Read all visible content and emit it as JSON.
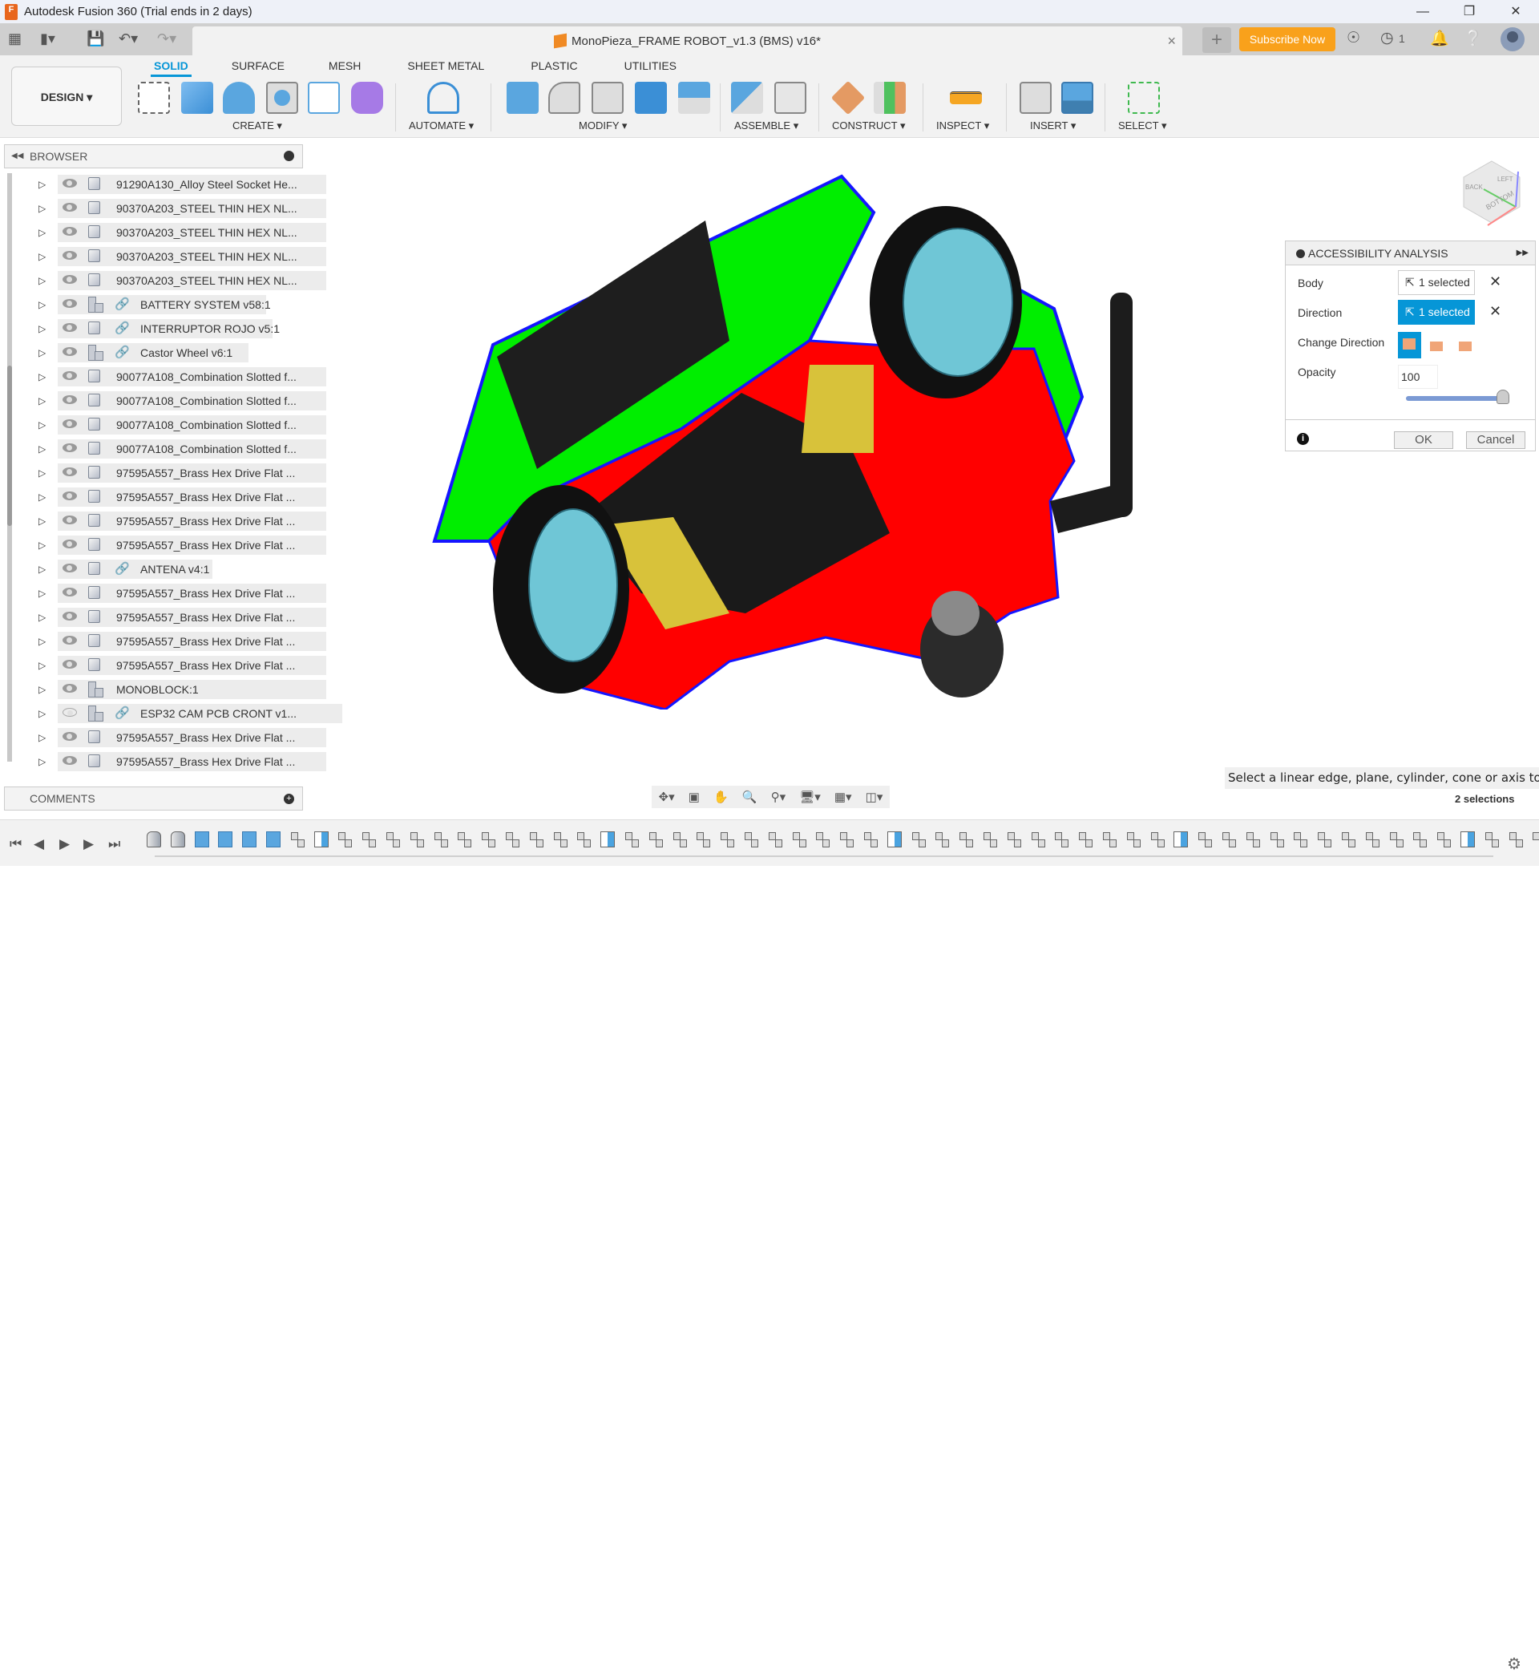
{
  "window": {
    "title": "Autodesk Fusion 360 (Trial ends in 2 days)",
    "app_icon_label": "F",
    "controls": [
      "minimize",
      "restore",
      "close"
    ]
  },
  "qat": {
    "icons": [
      "apps-grid-icon",
      "file-icon",
      "save-icon",
      "undo-icon",
      "redo-icon"
    ]
  },
  "document_tab": {
    "title": "MonoPieza_FRAME ROBOT_v1.3 (BMS) v16*",
    "close": "×"
  },
  "header_right": {
    "new_tab": "+",
    "subscribe_label": "Subscribe Now",
    "job_count": "1",
    "accent": "#f9a11b"
  },
  "ribbon": {
    "workspace": "DESIGN ▾",
    "tabs": [
      {
        "label": "SOLID",
        "active": true
      },
      {
        "label": "SURFACE",
        "active": false
      },
      {
        "label": "MESH",
        "active": false
      },
      {
        "label": "SHEET METAL",
        "active": false
      },
      {
        "label": "PLASTIC",
        "active": false
      },
      {
        "label": "UTILITIES",
        "active": false
      }
    ],
    "groups": [
      {
        "label": "CREATE ▾"
      },
      {
        "label": "AUTOMATE ▾"
      },
      {
        "label": "MODIFY ▾"
      },
      {
        "label": "ASSEMBLE ▾"
      },
      {
        "label": "CONSTRUCT ▾"
      },
      {
        "label": "INSPECT ▾"
      },
      {
        "label": "INSERT ▾"
      },
      {
        "label": "SELECT ▾"
      }
    ],
    "accent": "#0696d7"
  },
  "browser": {
    "title": "BROWSER",
    "items": [
      {
        "name": "91290A130_Alloy Steel Socket He...",
        "type": "body",
        "linked": false,
        "visible": true
      },
      {
        "name": "90370A203_STEEL THIN HEX NL...",
        "type": "body",
        "linked": false,
        "visible": true
      },
      {
        "name": "90370A203_STEEL THIN HEX NL...",
        "type": "body",
        "linked": false,
        "visible": true
      },
      {
        "name": "90370A203_STEEL THIN HEX NL...",
        "type": "body",
        "linked": false,
        "visible": true
      },
      {
        "name": "90370A203_STEEL THIN HEX NL...",
        "type": "body",
        "linked": false,
        "visible": true
      },
      {
        "name": "BATTERY SYSTEM v58:1",
        "type": "component",
        "linked": true,
        "visible": true
      },
      {
        "name": "INTERRUPTOR ROJO v5:1",
        "type": "body",
        "linked": true,
        "visible": true
      },
      {
        "name": "Castor Wheel v6:1",
        "type": "component",
        "linked": true,
        "visible": true
      },
      {
        "name": "90077A108_Combination Slotted f...",
        "type": "body",
        "linked": false,
        "visible": true
      },
      {
        "name": "90077A108_Combination Slotted f...",
        "type": "body",
        "linked": false,
        "visible": true
      },
      {
        "name": "90077A108_Combination Slotted f...",
        "type": "body",
        "linked": false,
        "visible": true
      },
      {
        "name": "90077A108_Combination Slotted f...",
        "type": "body",
        "linked": false,
        "visible": true
      },
      {
        "name": "97595A557_Brass Hex Drive Flat ...",
        "type": "body",
        "linked": false,
        "visible": true
      },
      {
        "name": "97595A557_Brass Hex Drive Flat ...",
        "type": "body",
        "linked": false,
        "visible": true
      },
      {
        "name": "97595A557_Brass Hex Drive Flat ...",
        "type": "body",
        "linked": false,
        "visible": true
      },
      {
        "name": "97595A557_Brass Hex Drive Flat ...",
        "type": "body",
        "linked": false,
        "visible": true
      },
      {
        "name": "ANTENA v4:1",
        "type": "body",
        "linked": true,
        "visible": true
      },
      {
        "name": "97595A557_Brass Hex Drive Flat ...",
        "type": "body",
        "linked": false,
        "visible": true
      },
      {
        "name": "97595A557_Brass Hex Drive Flat ...",
        "type": "body",
        "linked": false,
        "visible": true
      },
      {
        "name": "97595A557_Brass Hex Drive Flat ...",
        "type": "body",
        "linked": false,
        "visible": true
      },
      {
        "name": "97595A557_Brass Hex Drive Flat ...",
        "type": "body",
        "linked": false,
        "visible": true
      },
      {
        "name": "MONOBLOCK:1",
        "type": "component",
        "linked": false,
        "visible": true
      },
      {
        "name": "ESP32 CAM PCB CRONT v1...",
        "type": "component",
        "linked": true,
        "visible": false
      },
      {
        "name": "97595A557_Brass Hex Drive Flat ...",
        "type": "body",
        "linked": false,
        "visible": true
      },
      {
        "name": "97595A557_Brass Hex Drive Flat ...",
        "type": "body",
        "linked": false,
        "visible": true
      }
    ]
  },
  "comments": {
    "title": "COMMENTS"
  },
  "viewcube": {
    "faces": [
      "BOTTOM",
      "LEFT",
      "BACK"
    ],
    "axes": [
      "X",
      "Y",
      "Z"
    ]
  },
  "dialog": {
    "title": "ACCESSIBILITY ANALYSIS",
    "body_label": "Body",
    "body_value": "1 selected",
    "direction_label": "Direction",
    "direction_value": "1 selected",
    "change_direction_label": "Change Direction",
    "opacity_label": "Opacity",
    "opacity_value": "100",
    "opacity_slider_percent": 100,
    "ok_label": "OK",
    "cancel_label": "Cancel"
  },
  "status": {
    "prompt": "Select a linear edge, plane, cylinder, cone or axis to indicate",
    "selections": "2 selections"
  },
  "navbar": {
    "icons": [
      "orbit-icon",
      "look-at-icon",
      "pan-icon",
      "zoom-icon",
      "fit-icon",
      "display-settings-icon",
      "grid-icon",
      "viewports-icon"
    ]
  },
  "timeline": {
    "controls": [
      "first-icon",
      "previous-icon",
      "play-icon",
      "next-icon",
      "last-icon"
    ]
  },
  "model_colors": {
    "frame": "#ff0000",
    "side_panels": "#00ee00",
    "edge_highlight": "#1515ff",
    "wheel_hub": "#6fc6d6",
    "tire": "#111111",
    "motor": "#d8c23a"
  }
}
